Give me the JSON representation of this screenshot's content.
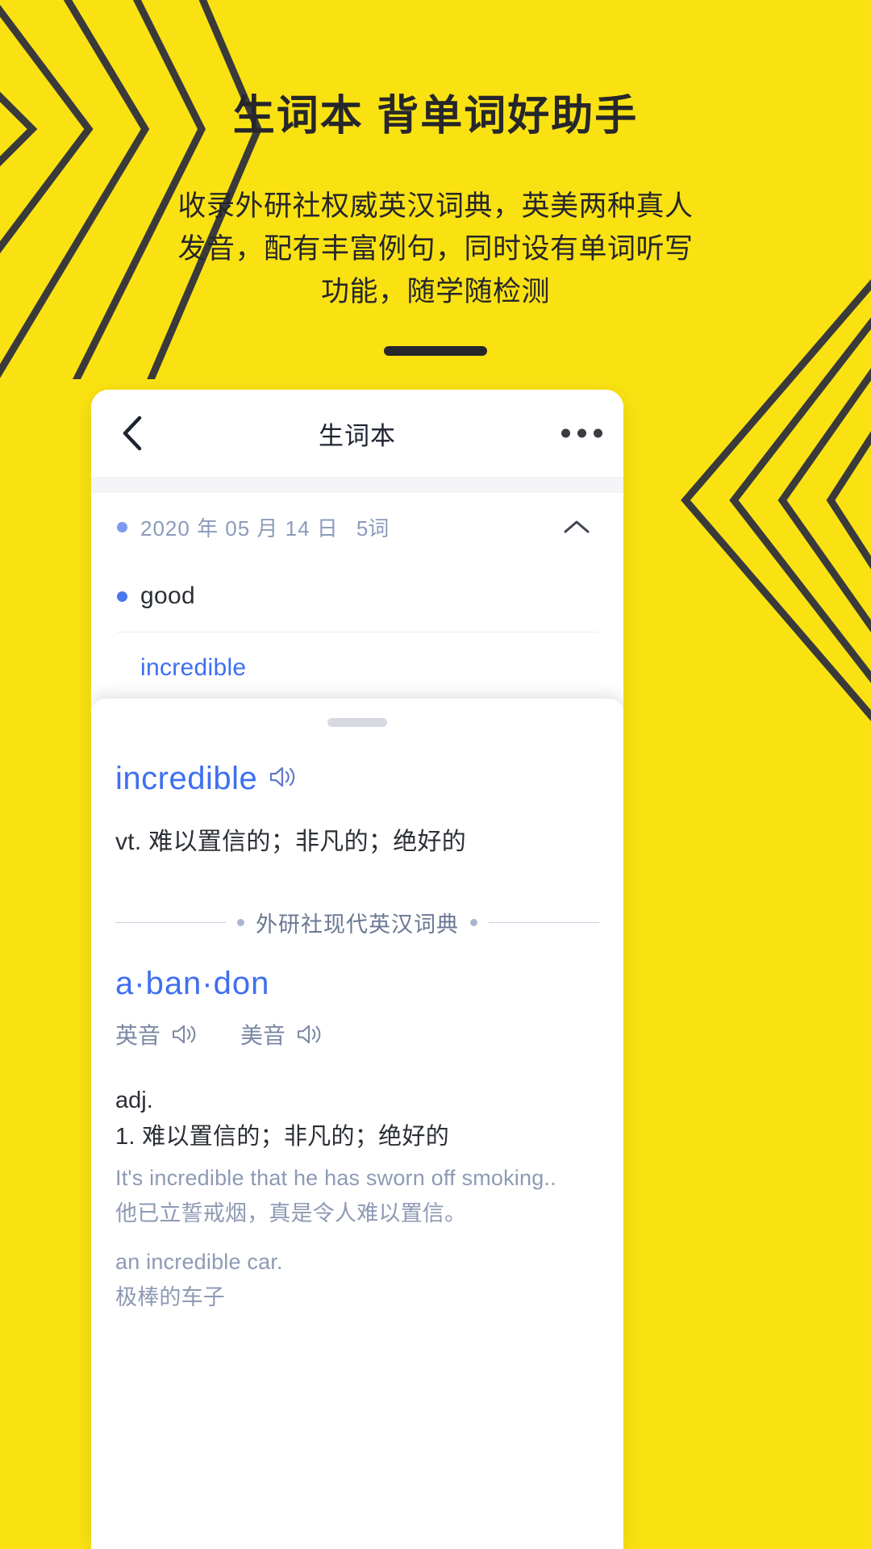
{
  "theme": {
    "background": "#FAE212",
    "ink": "#26262b",
    "accent_blue": "#3f6ff0",
    "muted_blue": "#8e9ab4"
  },
  "hero": {
    "title": "生词本  背单词好助手",
    "subtitle": "收录外研社权威英汉词典，英美两种真人发音，配有丰富例句，同时设有单词听写功能，随学随检测"
  },
  "phone": {
    "navbar": {
      "back_icon": "chevron-left-icon",
      "title": "生词本",
      "more_icon": "more-horizontal-icon"
    },
    "wordlist": {
      "group": {
        "date": "2020 年 05 月 14 日",
        "count": "5词",
        "toggle_icon": "chevron-up-icon"
      },
      "words": [
        {
          "text": "good",
          "has_dot": true,
          "is_link": false
        },
        {
          "text": "incredible",
          "has_dot": false,
          "is_link": true
        }
      ]
    },
    "sheet": {
      "handle": "drag-handle",
      "entry": {
        "word": "incredible",
        "speaker_icon": "speaker-icon",
        "definition": "vt. 难以置信的；非凡的；绝好的"
      },
      "dictionary_name": "外研社现代英汉词典",
      "headword": "a·ban·don",
      "pronunciations": [
        {
          "label": "英音",
          "icon": "speaker-icon"
        },
        {
          "label": "美音",
          "icon": "speaker-icon"
        }
      ],
      "part_of_speech": "adj.",
      "sense": "1. 难以置信的；非凡的；绝好的",
      "examples": [
        {
          "en": "It's incredible that he has sworn off smoking..",
          "zh": "他已立誓戒烟，真是令人难以置信。"
        },
        {
          "en": "an incredible car.",
          "zh": "极棒的车子"
        }
      ]
    }
  }
}
